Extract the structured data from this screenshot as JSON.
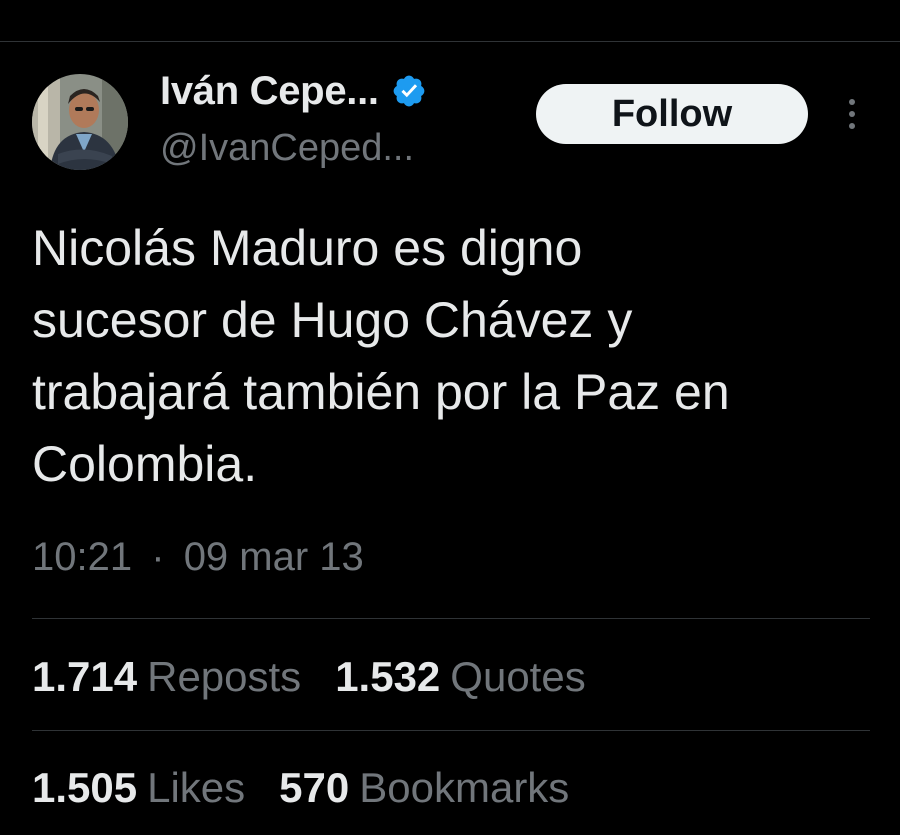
{
  "author": {
    "display_name": "Iván Cepe...",
    "handle": "@IvanCeped...",
    "verified_color": "#1d9bf0"
  },
  "follow_button": {
    "label": "Follow"
  },
  "tweet": {
    "text": "Nicolás Maduro es digno\nsucesor de Hugo Chávez y\ntrabajará también por la Paz en\nColombia.",
    "time": "10:21",
    "separator": "·",
    "date": "09 mar 13"
  },
  "stats": {
    "reposts": {
      "count": "1.714",
      "label": "Reposts"
    },
    "quotes": {
      "count": "1.532",
      "label": "Quotes"
    },
    "likes": {
      "count": "1.505",
      "label": "Likes"
    },
    "bookmarks": {
      "count": "570",
      "label": "Bookmarks"
    }
  },
  "icons": {
    "more": "more-vertical-icon",
    "verified": "verified-badge-icon",
    "avatar": "avatar-photo"
  }
}
